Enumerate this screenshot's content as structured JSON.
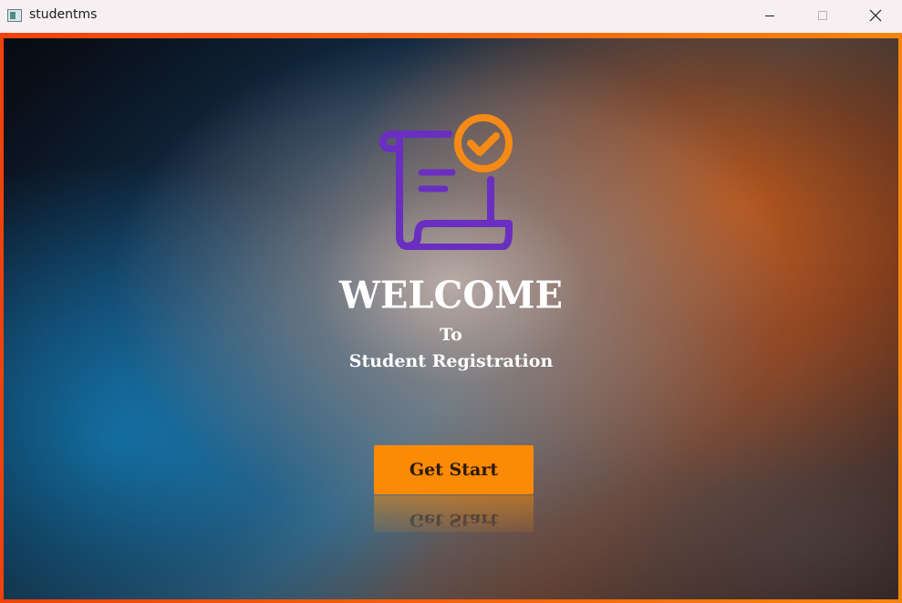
{
  "window": {
    "title": "studentms",
    "controls": {
      "minimize_icon": "minimize-icon",
      "maximize_icon": "maximize-icon",
      "close_icon": "close-icon"
    }
  },
  "welcome_screen": {
    "logo_icon": "certificate-scroll-check-icon",
    "heading": "WELCOME",
    "to_text": "To",
    "subtitle": "Student Registration",
    "start_button_label": "Get Start"
  },
  "colors": {
    "frame_border_start": "#f0420d",
    "frame_border_end": "#f3850f",
    "button_bg": "#fb8a04",
    "logo_purple": "#6a2fc0",
    "logo_orange": "#f58a16",
    "text_white": "#ffffff"
  }
}
